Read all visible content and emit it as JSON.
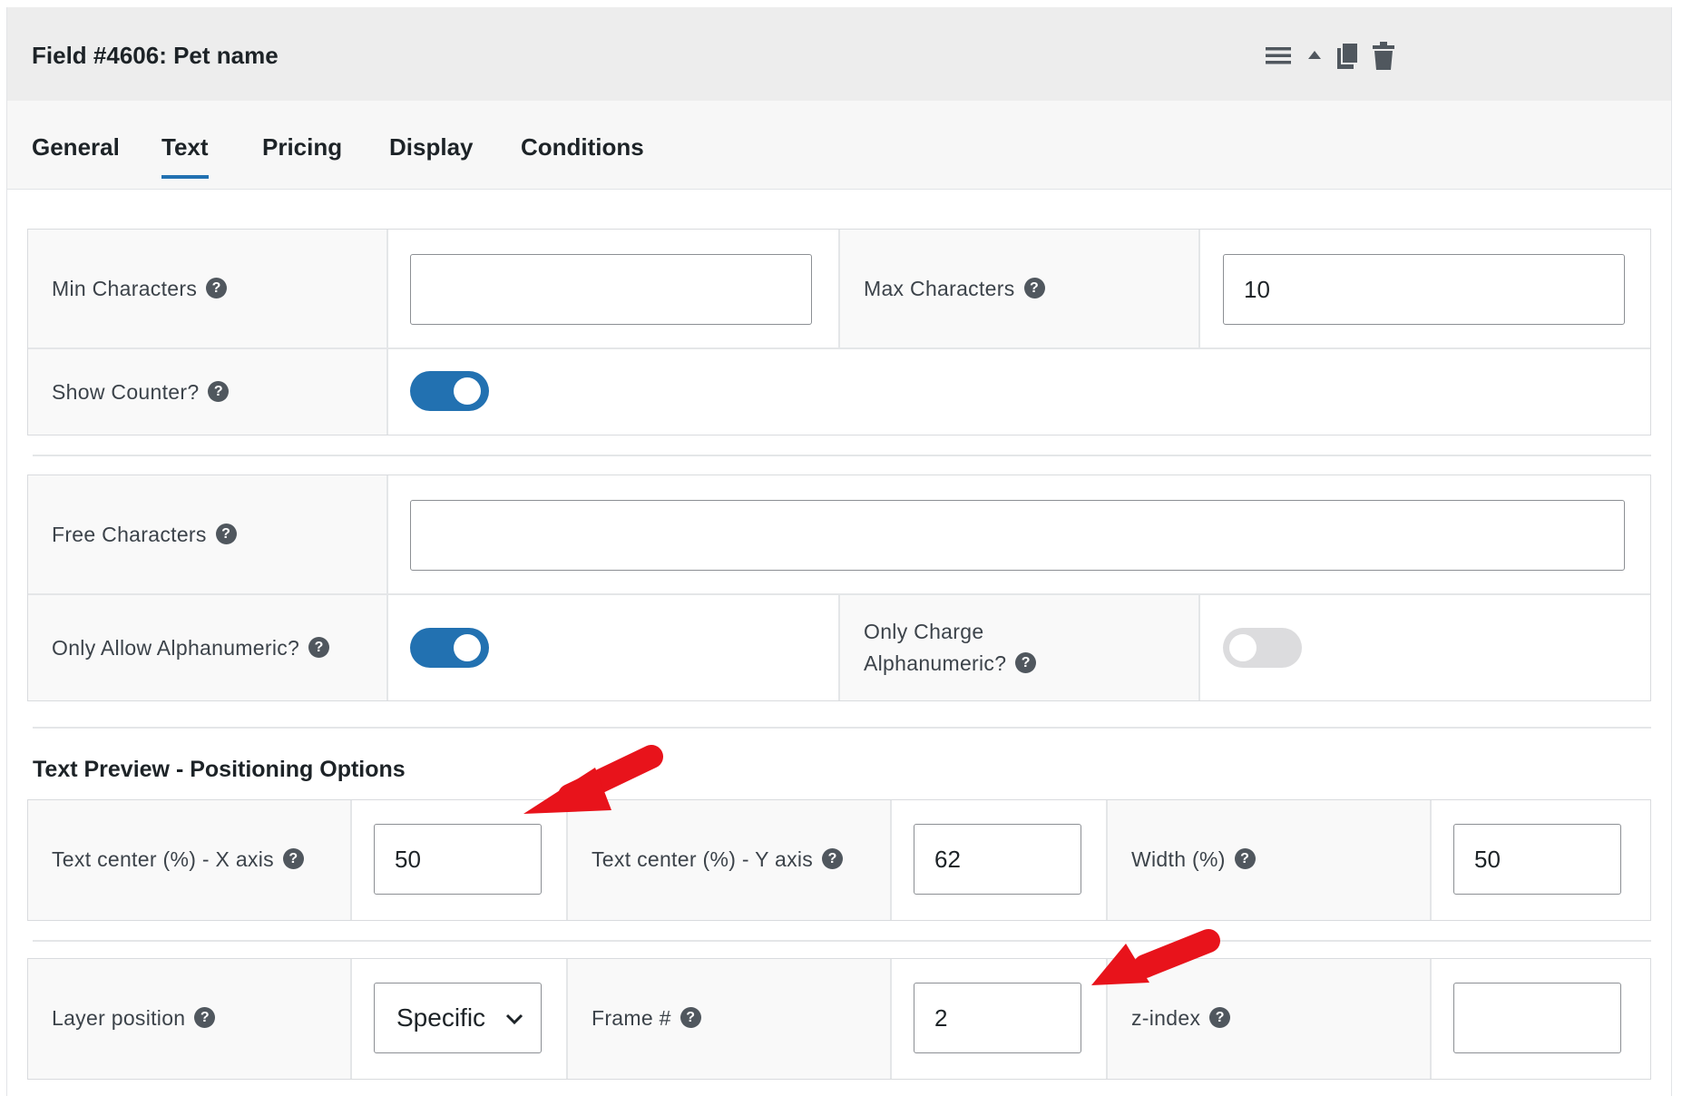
{
  "header": {
    "title": "Field #4606: Pet name",
    "icons": [
      "menu-icon",
      "collapse-up-icon",
      "duplicate-icon",
      "trash-icon"
    ]
  },
  "tabs": [
    {
      "label": "General",
      "active": false
    },
    {
      "label": "Text",
      "active": true
    },
    {
      "label": "Pricing",
      "active": false
    },
    {
      "label": "Display",
      "active": false
    },
    {
      "label": "Conditions",
      "active": false
    }
  ],
  "help_glyph": "?",
  "text_settings": {
    "min_characters": {
      "label": "Min Characters",
      "value": "",
      "placeholder": ""
    },
    "max_characters": {
      "label": "Max Characters",
      "value": "10"
    },
    "show_counter": {
      "label": "Show Counter?",
      "enabled": true
    },
    "free_characters": {
      "label": "Free Characters",
      "value": ""
    },
    "only_allow_alphanumeric": {
      "label": "Only Allow Alphanumeric?",
      "enabled": true
    },
    "only_charge_alphanumeric": {
      "label_line1": "Only Charge",
      "label_line2": "Alphanumeric?",
      "enabled": false
    }
  },
  "positioning": {
    "section_title": "Text Preview - Positioning Options",
    "x_axis": {
      "label": "Text center (%) - X axis",
      "value": "50"
    },
    "y_axis": {
      "label": "Text center (%) - Y axis",
      "value": "62"
    },
    "width": {
      "label": "Width (%)",
      "value": "50"
    },
    "layer_position": {
      "label": "Layer position",
      "selected": "Specific"
    },
    "frame": {
      "label": "Frame #",
      "value": "2"
    },
    "z_index": {
      "label": "z-index",
      "value": ""
    }
  },
  "colors": {
    "accent": "#2271b1",
    "annotation_arrow": "#e8131b",
    "header_bg": "#ededed"
  }
}
